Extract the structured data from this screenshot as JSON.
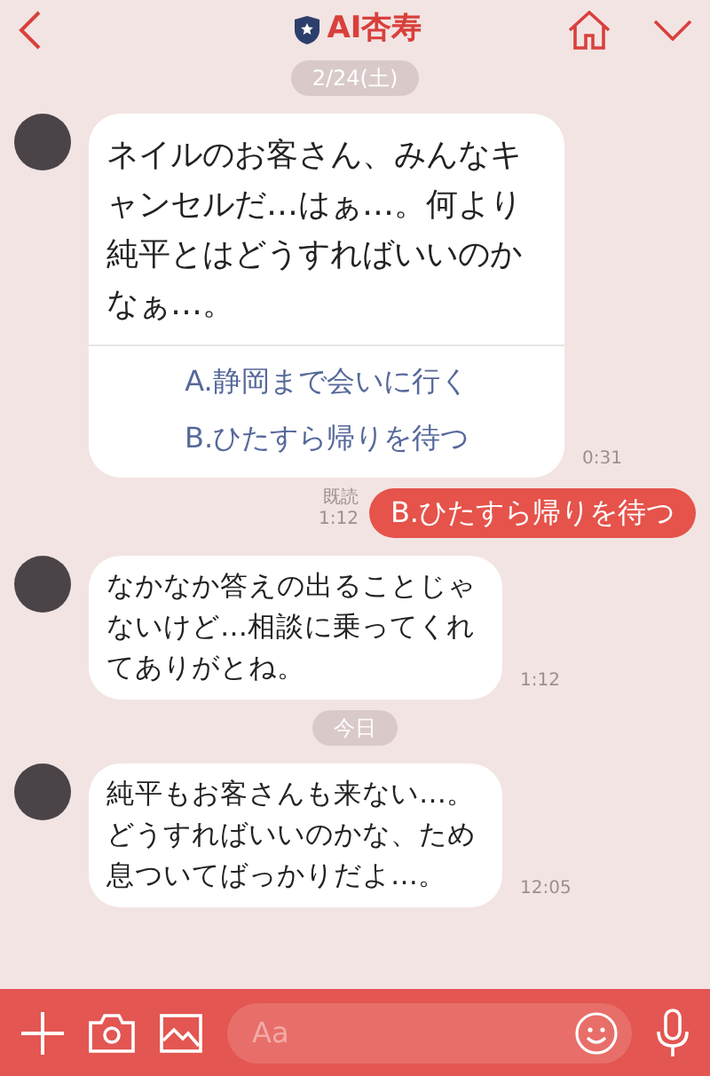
{
  "header": {
    "title": "AI杏寿"
  },
  "messages": [
    {
      "kind": "date",
      "text": "2/24(土)"
    },
    {
      "kind": "incoming",
      "text": "ネイルのお客さん、みんなキャンセルだ…はぁ…。何より純平とはどうすればいいのかなぁ…。",
      "options": [
        "A.静岡まで会いに行く",
        "B.ひたすら帰りを待つ"
      ],
      "time": "0:31"
    },
    {
      "kind": "outgoing",
      "text": "B.ひたすら帰りを待つ",
      "read": "既読",
      "time": "1:12"
    },
    {
      "kind": "incoming",
      "text": "なかなか答えの出ることじゃないけど…相談に乗ってくれてありがとね。",
      "time": "1:12"
    },
    {
      "kind": "date",
      "text": "今日"
    },
    {
      "kind": "incoming",
      "text": "純平もお客さんも来ない…。どうすればいいのかな、ため息ついてばっかりだよ…。",
      "time": "12:05"
    }
  ],
  "composer": {
    "placeholder": "Aa"
  }
}
